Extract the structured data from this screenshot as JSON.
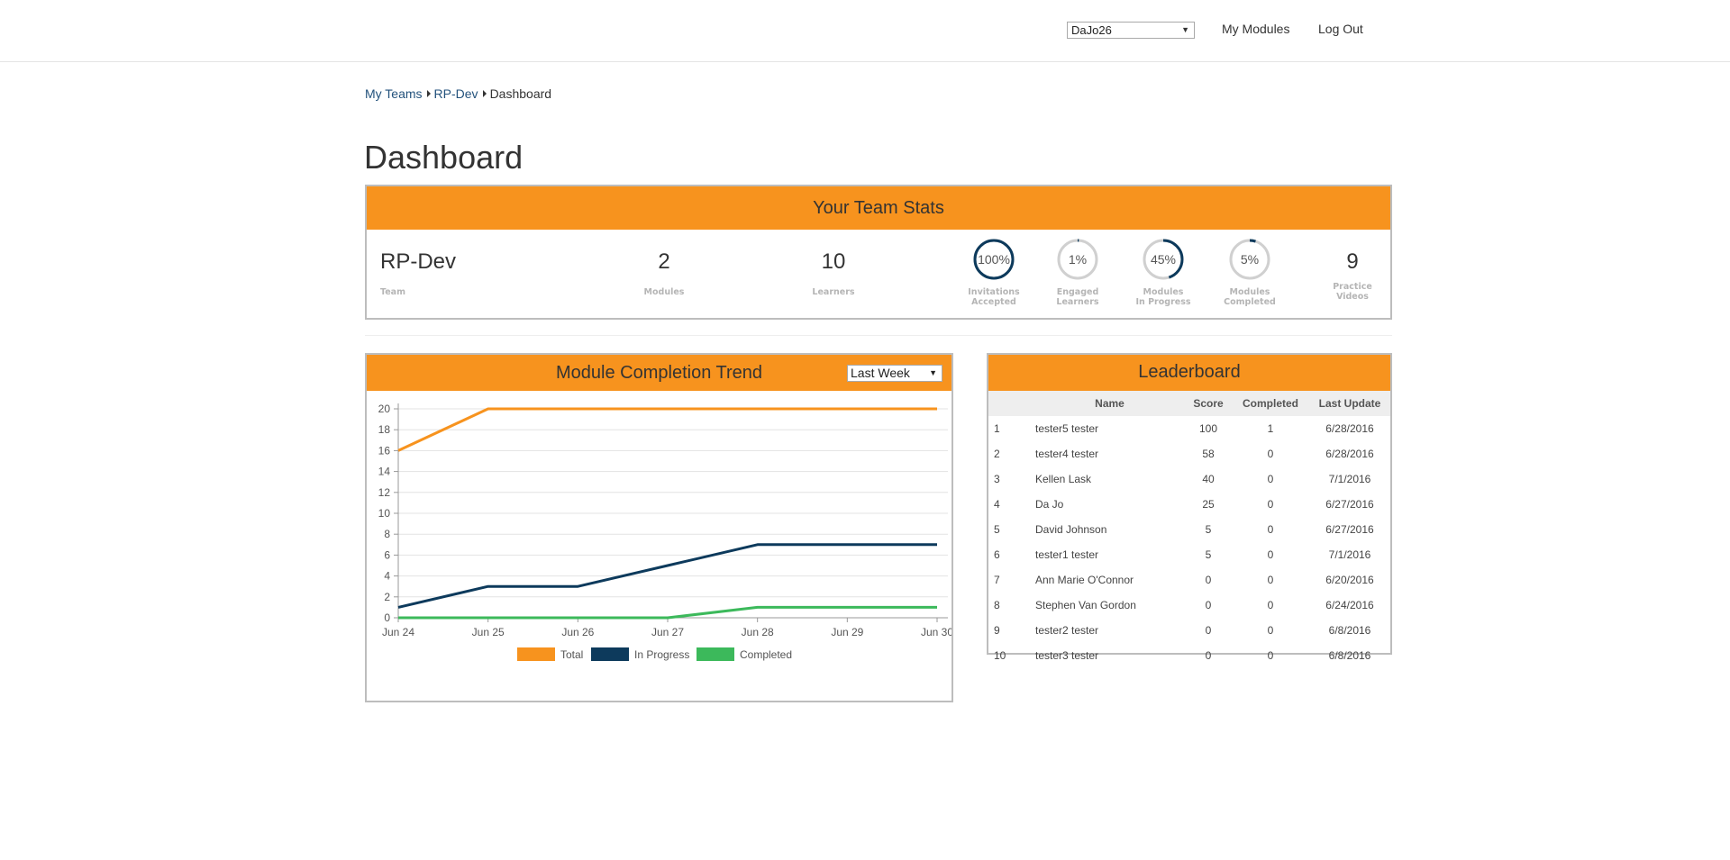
{
  "header": {
    "user_select_value": "DaJo26",
    "nav": [
      {
        "label": "My Modules"
      },
      {
        "label": "Log Out"
      }
    ]
  },
  "breadcrumb": {
    "items": [
      "My Teams",
      "RP-Dev",
      "Dashboard"
    ]
  },
  "page_title": "Dashboard",
  "team_stats": {
    "title": "Your Team Stats",
    "team": {
      "value": "RP-Dev",
      "label": "Team"
    },
    "modules": {
      "value": "2",
      "label": "Modules"
    },
    "learners": {
      "value": "10",
      "label": "Learners"
    },
    "rings": [
      {
        "value": "100%",
        "fraction": 1.0,
        "label1": "Invitations",
        "label2": "Accepted"
      },
      {
        "value": "1%",
        "fraction": 0.01,
        "label1": "Engaged",
        "label2": "Learners"
      },
      {
        "value": "45%",
        "fraction": 0.45,
        "label1": "Modules",
        "label2": "In Progress"
      },
      {
        "value": "5%",
        "fraction": 0.05,
        "label1": "Modules",
        "label2": "Completed"
      }
    ],
    "practice_videos": {
      "value": "9",
      "label1": "Practice",
      "label2": "Videos"
    }
  },
  "trend": {
    "title": "Module Completion Trend",
    "range_value": "Last Week"
  },
  "chart_data": {
    "type": "line",
    "x": [
      "Jun 24",
      "Jun 25",
      "Jun 26",
      "Jun 27",
      "Jun 28",
      "Jun 29",
      "Jun 30"
    ],
    "series": [
      {
        "name": "Total",
        "values": [
          16,
          20,
          20,
          20,
          20,
          20,
          20
        ],
        "color": "#f7931e"
      },
      {
        "name": "In Progress",
        "values": [
          1,
          3,
          3,
          5,
          7,
          7,
          7
        ],
        "color": "#0d3a5c"
      },
      {
        "name": "Completed",
        "values": [
          0,
          0,
          0,
          0,
          1,
          1,
          1
        ],
        "color": "#3cb95b"
      }
    ],
    "yticks": [
      "0",
      "2",
      "4",
      "6",
      "8",
      "10",
      "12",
      "14",
      "16",
      "18",
      "20"
    ],
    "ylim": [
      0,
      20
    ],
    "grid": true,
    "legend": "bottom"
  },
  "leaderboard": {
    "title": "Leaderboard",
    "columns": [
      "",
      "Name",
      "Score",
      "Completed",
      "Last Update"
    ],
    "rows": [
      [
        "1",
        "tester5 tester",
        "100",
        "1",
        "6/28/2016"
      ],
      [
        "2",
        "tester4 tester",
        "58",
        "0",
        "6/28/2016"
      ],
      [
        "3",
        "Kellen Lask",
        "40",
        "0",
        "7/1/2016"
      ],
      [
        "4",
        "Da Jo",
        "25",
        "0",
        "6/27/2016"
      ],
      [
        "5",
        "David Johnson",
        "5",
        "0",
        "6/27/2016"
      ],
      [
        "6",
        "tester1 tester",
        "5",
        "0",
        "7/1/2016"
      ],
      [
        "7",
        "Ann Marie O'Connor",
        "0",
        "0",
        "6/20/2016"
      ],
      [
        "8",
        "Stephen Van Gordon",
        "0",
        "0",
        "6/24/2016"
      ],
      [
        "9",
        "tester2 tester",
        "0",
        "0",
        "6/8/2016"
      ],
      [
        "10",
        "tester3 tester",
        "0",
        "0",
        "6/8/2016"
      ]
    ]
  },
  "colors": {
    "accent": "#f7931e",
    "ring_active": "#0d3a5c",
    "ring_track": "#d0d0d0"
  }
}
